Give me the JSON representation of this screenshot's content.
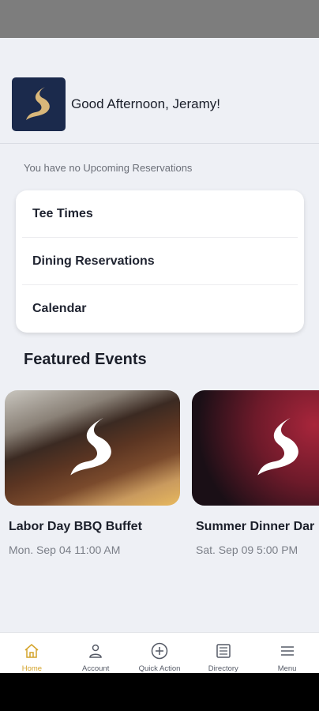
{
  "header": {
    "greeting": "Good Afternoon, Jeramy!",
    "brand_color": "#1b2a4c",
    "logo_color": "#d9b77a"
  },
  "reservations": {
    "empty_text": "You have no Upcoming Reservations",
    "items": [
      {
        "label": "Tee Times"
      },
      {
        "label": "Dining Reservations"
      },
      {
        "label": "Calendar"
      }
    ]
  },
  "featured": {
    "title": "Featured Events",
    "events": [
      {
        "title": "Labor Day BBQ Buffet",
        "date": "Mon. Sep 04 11:00 AM"
      },
      {
        "title": "Summer Dinner Dar",
        "date": "Sat. Sep 09 5:00 PM"
      }
    ]
  },
  "bottom_nav": {
    "active_color": "#d4a32a",
    "items": [
      {
        "label": "Home",
        "icon": "home-icon"
      },
      {
        "label": "Account",
        "icon": "person-icon"
      },
      {
        "label": "Quick Action",
        "icon": "plus-circle-icon"
      },
      {
        "label": "Directory",
        "icon": "list-icon"
      },
      {
        "label": "Menu",
        "icon": "menu-icon"
      }
    ]
  }
}
